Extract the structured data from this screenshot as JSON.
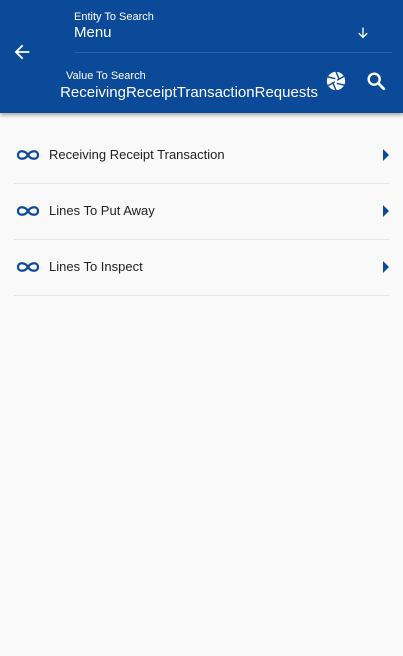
{
  "header": {
    "entity_label": "Entity To Search",
    "entity_value": "Menu",
    "value_label": "Value To Search",
    "value_text": "ReceivingReceiptTransactionRequests",
    "icons": {
      "back": "arrow-left-icon",
      "dropdown": "arrow-down-icon",
      "scan": "camera-aperture-icon",
      "search": "search-icon"
    },
    "colors": {
      "header_bg": "#0b4a99",
      "accent": "#0b4a99"
    }
  },
  "menu_items": [
    {
      "label": "Receiving Receipt Transaction",
      "icon": "link-icon"
    },
    {
      "label": "Lines To Put Away",
      "icon": "link-icon"
    },
    {
      "label": "Lines To Inspect",
      "icon": "link-icon"
    }
  ]
}
